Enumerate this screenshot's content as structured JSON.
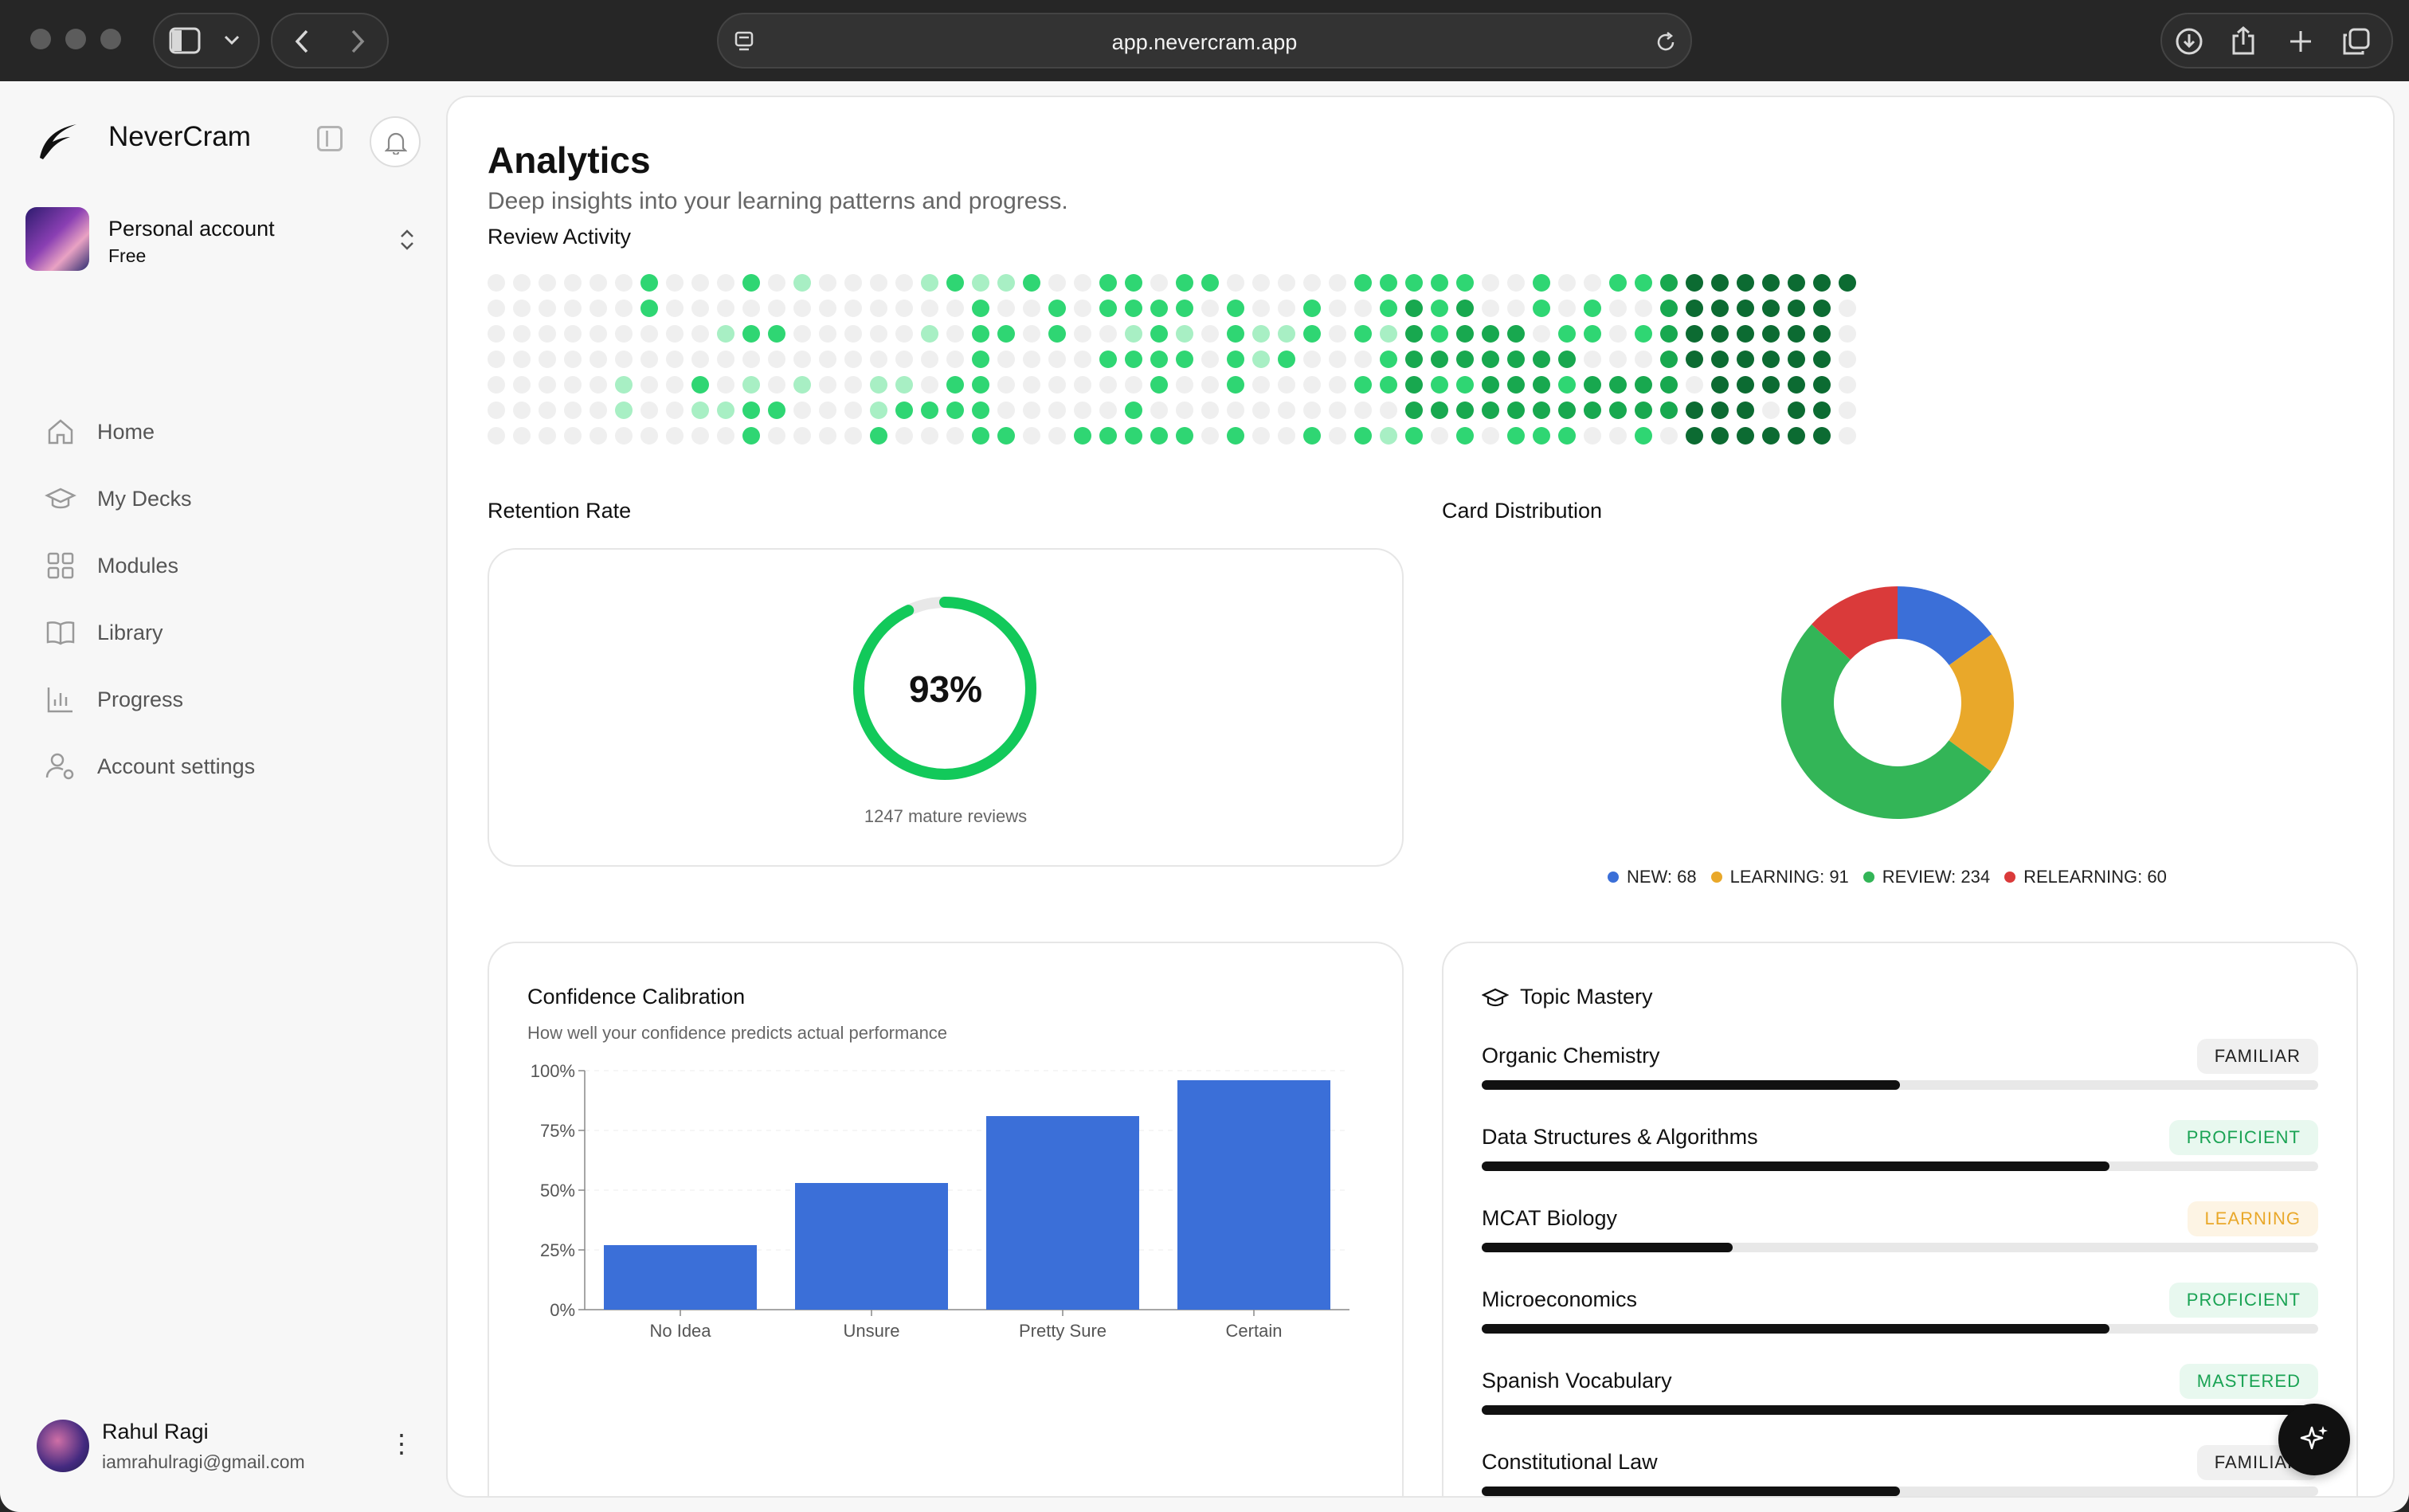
{
  "browser": {
    "url": "app.nevercram.app"
  },
  "sidebar": {
    "brand": "NeverCram",
    "account": {
      "name": "Personal account",
      "plan": "Free"
    },
    "nav": [
      {
        "label": "Home",
        "icon": "home-icon"
      },
      {
        "label": "My Decks",
        "icon": "graduation-cap-icon"
      },
      {
        "label": "Modules",
        "icon": "grid-icon"
      },
      {
        "label": "Library",
        "icon": "book-icon"
      },
      {
        "label": "Progress",
        "icon": "bar-chart-icon"
      },
      {
        "label": "Account settings",
        "icon": "user-settings-icon"
      }
    ],
    "user": {
      "name": "Rahul Ragi",
      "email": "iamrahulragi@gmail.com"
    }
  },
  "page": {
    "title": "Analytics",
    "subtitle": "Deep insights into your learning patterns and progress.",
    "review_activity_label": "Review Activity",
    "retention_label": "Retention Rate",
    "distribution_label": "Card Distribution"
  },
  "retention": {
    "value": "93%",
    "fraction": 0.93,
    "caption": "1247 mature reviews"
  },
  "distribution": {
    "legend": [
      {
        "label": "NEW: 68",
        "color": "#3b6fd8"
      },
      {
        "label": "LEARNING: 91",
        "color": "#e9a82a"
      },
      {
        "label": "REVIEW: 234",
        "color": "#33b557"
      },
      {
        "label": "RELEARNING: 60",
        "color": "#da3a3a"
      }
    ]
  },
  "chart_data": [
    {
      "type": "pie",
      "categories": [
        "NEW",
        "LEARNING",
        "REVIEW",
        "RELEARNING"
      ],
      "values": [
        68,
        91,
        234,
        60
      ],
      "colors": [
        "#3b6fd8",
        "#e9a82a",
        "#33b557",
        "#da3a3a"
      ]
    },
    {
      "type": "bar",
      "title": "Confidence Calibration",
      "subtitle": "How well your confidence predicts actual performance",
      "categories": [
        "No Idea",
        "Unsure",
        "Pretty Sure",
        "Certain"
      ],
      "values": [
        27,
        53,
        81,
        96
      ],
      "ylim": [
        0,
        100
      ],
      "yticks": [
        "0%",
        "25%",
        "50%",
        "75%",
        "100%"
      ],
      "color": "#3b6fd8"
    }
  ],
  "heatmap": {
    "colors": [
      "#efefef",
      "#a8efc4",
      "#2fd673",
      "#18a84f",
      "#0c6b32"
    ],
    "columns": [
      [
        0,
        0,
        0,
        0,
        0,
        0,
        0
      ],
      [
        0,
        0,
        0,
        0,
        0,
        0,
        0
      ],
      [
        0,
        0,
        0,
        0,
        0,
        0,
        0
      ],
      [
        0,
        0,
        0,
        0,
        0,
        0,
        0
      ],
      [
        0,
        0,
        0,
        0,
        0,
        0,
        0
      ],
      [
        0,
        0,
        0,
        0,
        1,
        1,
        0
      ],
      [
        2,
        2,
        0,
        0,
        0,
        0,
        0
      ],
      [
        0,
        0,
        0,
        0,
        0,
        0,
        0
      ],
      [
        0,
        0,
        0,
        0,
        2,
        1,
        0
      ],
      [
        0,
        0,
        1,
        0,
        0,
        1,
        0
      ],
      [
        2,
        0,
        2,
        0,
        1,
        2,
        2
      ],
      [
        0,
        0,
        2,
        0,
        0,
        2,
        0
      ],
      [
        1,
        0,
        0,
        0,
        1,
        0,
        0
      ],
      [
        0,
        0,
        0,
        0,
        0,
        0,
        0
      ],
      [
        0,
        0,
        0,
        0,
        0,
        0,
        0
      ],
      [
        0,
        0,
        0,
        0,
        1,
        1,
        2
      ],
      [
        0,
        0,
        0,
        0,
        1,
        2,
        0
      ],
      [
        1,
        0,
        1,
        0,
        0,
        2,
        0
      ],
      [
        2,
        0,
        0,
        0,
        2,
        2,
        0
      ],
      [
        1,
        2,
        2,
        2,
        2,
        2,
        2
      ],
      [
        1,
        0,
        2,
        0,
        0,
        0,
        2
      ],
      [
        2,
        0,
        0,
        0,
        0,
        0,
        0
      ],
      [
        0,
        2,
        2,
        0,
        0,
        0,
        0
      ],
      [
        0,
        0,
        0,
        0,
        0,
        0,
        2
      ],
      [
        2,
        2,
        0,
        2,
        0,
        0,
        2
      ],
      [
        2,
        2,
        1,
        2,
        0,
        2,
        2
      ],
      [
        0,
        2,
        2,
        2,
        2,
        0,
        2
      ],
      [
        2,
        2,
        1,
        2,
        0,
        0,
        2
      ],
      [
        2,
        0,
        0,
        0,
        0,
        0,
        0
      ],
      [
        0,
        2,
        2,
        2,
        2,
        0,
        2
      ],
      [
        0,
        0,
        1,
        1,
        0,
        0,
        0
      ],
      [
        0,
        0,
        1,
        2,
        0,
        0,
        0
      ],
      [
        0,
        2,
        2,
        0,
        0,
        0,
        2
      ],
      [
        0,
        0,
        0,
        0,
        0,
        0,
        0
      ],
      [
        2,
        0,
        2,
        0,
        2,
        0,
        2
      ],
      [
        2,
        2,
        1,
        2,
        2,
        0,
        1
      ],
      [
        2,
        3,
        3,
        3,
        3,
        3,
        2
      ],
      [
        2,
        2,
        2,
        3,
        2,
        3,
        0
      ],
      [
        2,
        3,
        3,
        3,
        2,
        3,
        2
      ],
      [
        0,
        0,
        3,
        3,
        3,
        3,
        0
      ],
      [
        0,
        0,
        3,
        3,
        3,
        3,
        2
      ],
      [
        2,
        2,
        0,
        3,
        3,
        3,
        2
      ],
      [
        0,
        0,
        2,
        3,
        2,
        3,
        2
      ],
      [
        0,
        2,
        2,
        0,
        3,
        3,
        0
      ],
      [
        2,
        0,
        0,
        0,
        3,
        3,
        0
      ],
      [
        2,
        0,
        2,
        0,
        3,
        3,
        2
      ],
      [
        3,
        3,
        3,
        3,
        3,
        3,
        0
      ],
      [
        4,
        4,
        4,
        4,
        0,
        4,
        4
      ],
      [
        4,
        4,
        4,
        4,
        4,
        4,
        4
      ],
      [
        4,
        4,
        4,
        4,
        4,
        4,
        4
      ],
      [
        4,
        4,
        4,
        4,
        4,
        0,
        4
      ],
      [
        4,
        4,
        4,
        4,
        4,
        4,
        4
      ],
      [
        4,
        4,
        4,
        4,
        4,
        4,
        4
      ],
      [
        4,
        0,
        0,
        0,
        0,
        0,
        0
      ]
    ]
  },
  "topic_mastery": {
    "title": "Topic Mastery",
    "topics": [
      {
        "name": "Organic Chemistry",
        "badge": "FAMILIAR",
        "progress": 0.5,
        "badge_bg": "#f0f0f0",
        "badge_fg": "#222"
      },
      {
        "name": "Data Structures & Algorithms",
        "badge": "PROFICIENT",
        "progress": 0.75,
        "badge_bg": "#e8f8ef",
        "badge_fg": "#1aa354"
      },
      {
        "name": "MCAT Biology",
        "badge": "LEARNING",
        "progress": 0.3,
        "badge_bg": "#fdf4e4",
        "badge_fg": "#e9a82a"
      },
      {
        "name": "Microeconomics",
        "badge": "PROFICIENT",
        "progress": 0.75,
        "badge_bg": "#e8f8ef",
        "badge_fg": "#1aa354"
      },
      {
        "name": "Spanish Vocabulary",
        "badge": "MASTERED",
        "progress": 1.0,
        "badge_bg": "#e8f8ef",
        "badge_fg": "#1aa354"
      },
      {
        "name": "Constitutional Law",
        "badge": "FAMILIAR",
        "progress": 0.5,
        "badge_bg": "#f0f0f0",
        "badge_fg": "#222"
      }
    ]
  }
}
